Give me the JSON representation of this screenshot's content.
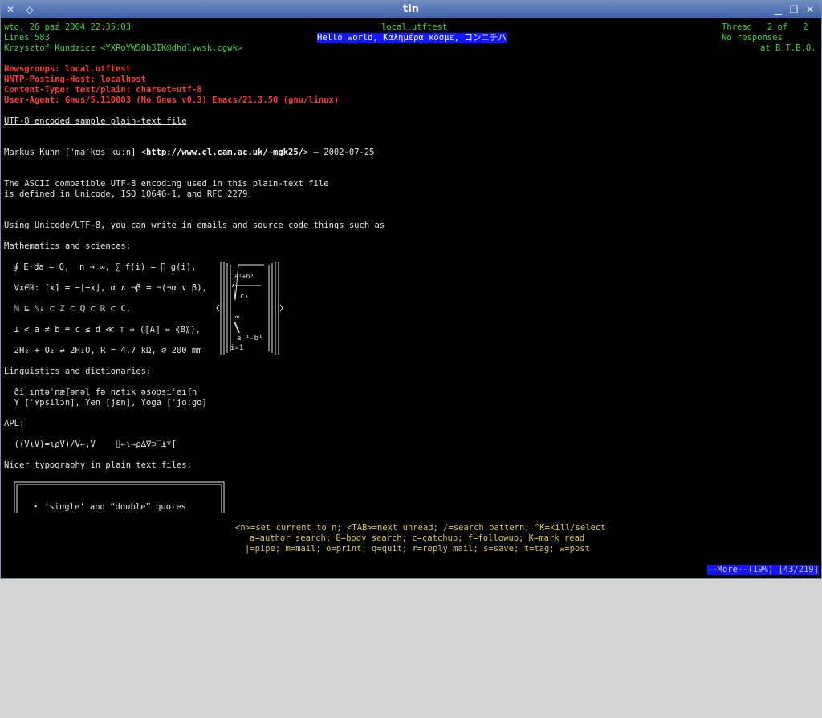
{
  "window": {
    "title": "tin"
  },
  "header": {
    "date": "wto, 26 paź 2004 22:35:03",
    "group": "local.utftest",
    "thread": "Thread   2 of   2",
    "lines": "Lines 583",
    "subject": "Hello world, Καλημέρα κόσμε, コンニチハ",
    "responses": "No responses",
    "author": "Krzysztof Kundzicz <YXRoYW50b3IK@dhdlywsk.cgwk>",
    "org": "at B.T.B.O."
  },
  "headers": [
    "Newsgroups: local.utftest",
    "NNTP-Posting-Host: localhost",
    "Content-Type: text/plain; charset=utf-8",
    "User-Agent: Gnus/5.110003 (No Gnus v0.3) Emacs/21.3.50 (gnu/linux)"
  ],
  "body": {
    "title": "UTF-8 encoded sample plain-text file",
    "author_line_pre": "Markus Kuhn [ˈmaʳkʊs kuːn] <",
    "author_url": "http://www.cl.cam.ac.uk/~mgk25/",
    "author_line_post": "> — 2002-07-25",
    "p1a": "The ASCII compatible UTF-8 encoding used in this plain-text file",
    "p1b": "is defined in Unicode, ISO 10646-1, and RFC 2279.",
    "p2": "Using Unicode/UTF-8, you can write in emails and source code things such as",
    "math_head": "Mathematics and sciences:",
    "math1": "  ∮ E⋅da = Q,  n → ∞, ∑ f(i) = ∏ g(i),",
    "math2": "  ∀x∈ℝ: ⌈x⌉ = −⌊−x⌋, α ∧ ¬β = ¬(¬α ∨ β),",
    "math3": "  ℕ ⊆ ℕ₀ ⊂ ℤ ⊂ ℚ ⊂ ℝ ⊂ ℂ,",
    "math4": "  ⊥ < a ≠ b ≡ c ≤ d ≪ ⊤ ⇒ (⟦A⟧ ⇔ ⟪B⟫),",
    "math5": "  2H₂ + O₂ ⇌ 2H₂O, R = 4.7 kΩ, ⌀ 200 mm",
    "formula_a": "a²+b³",
    "formula_c": "c₈",
    "formula_inf": "∞",
    "formula_sum": "⎲",
    "formula_ai": "a ⁱ-bⁱ",
    "formula_i1": "i=1",
    "ling_head": "Linguistics and dictionaries:",
    "ling1": "  ði ıntəˈnæʃənəl fəˈnɛtık əsoʊsiˈeıʃn",
    "ling2": "  Y [ˈʏpsilɔn], Yen [jɛn], Yoga [ˈjoːgɑ]",
    "apl_head": "APL:",
    "apl1": "  ((V⍳V)=⍳⍴V)/V←,V    ⌷←⍳→⍴∆∇⊃‾⍎⍕⌈",
    "typo_head": "Nicer typography in plain text files:",
    "typo_bullet": "•",
    "typo1": "‘single’ and “double” quotes"
  },
  "help": {
    "line1": "<n>=set current to n; <TAB>=next unread; /=search pattern; ^K=kill/select",
    "line2": "a=author search; B=body search; c=catchup; f=followup; K=mark read",
    "line3": "|=pipe; m=mail; o=print; q=quit; r=reply mail; s=save; t=tag; w=post"
  },
  "status": {
    "more": "--More--(19%) [43/219]"
  }
}
